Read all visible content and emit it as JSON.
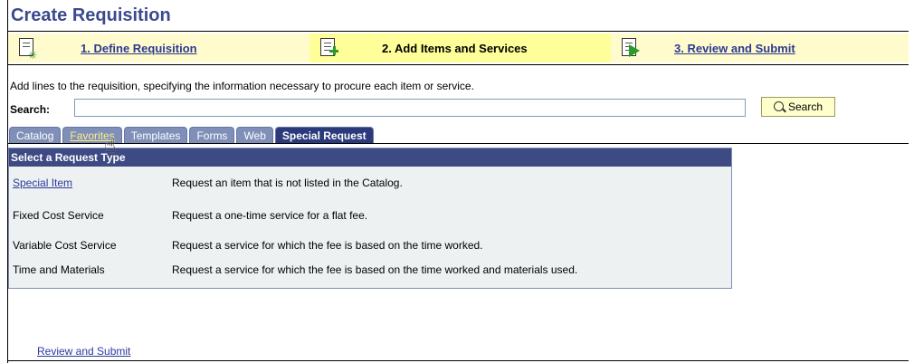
{
  "page": {
    "title": "Create Requisition"
  },
  "steps": [
    {
      "label": "1. Define Requisition",
      "icon": "doc-star-icon"
    },
    {
      "label": "2. Add Items and Services",
      "icon": "doc-plus-icon"
    },
    {
      "label": "3. Review and Submit",
      "icon": "doc-arrow-icon"
    }
  ],
  "instructions": "Add lines to the requisition, specifying the information necessary to procure each item or service.",
  "search": {
    "label": "Search:",
    "value": "",
    "button_label": "Search"
  },
  "tabs": [
    {
      "label": "Catalog"
    },
    {
      "label": "Favorites"
    },
    {
      "label": "Templates"
    },
    {
      "label": "Forms"
    },
    {
      "label": "Web"
    },
    {
      "label": "Special Request"
    }
  ],
  "request_type": {
    "header": "Select a Request Type",
    "rows": [
      {
        "name": "Special Item",
        "description": "Request an item that is not listed in the Catalog."
      },
      {
        "name": "Fixed Cost Service",
        "description": "Request a one-time service for a flat fee."
      },
      {
        "name": "Variable Cost Service",
        "description": "Request a service for which the fee is based on the time worked."
      },
      {
        "name": "Time and Materials",
        "description": "Request a service for which the fee is based on the time worked and materials used."
      }
    ]
  },
  "footer": {
    "review_link": "Review and Submit"
  },
  "colors": {
    "title": "#3b4a8f",
    "header_bg": "#3e4a84",
    "tab_bg": "#7f8fb8",
    "active_tab_bg": "#2a3a7a",
    "step_active_bg": "#ffff99"
  }
}
